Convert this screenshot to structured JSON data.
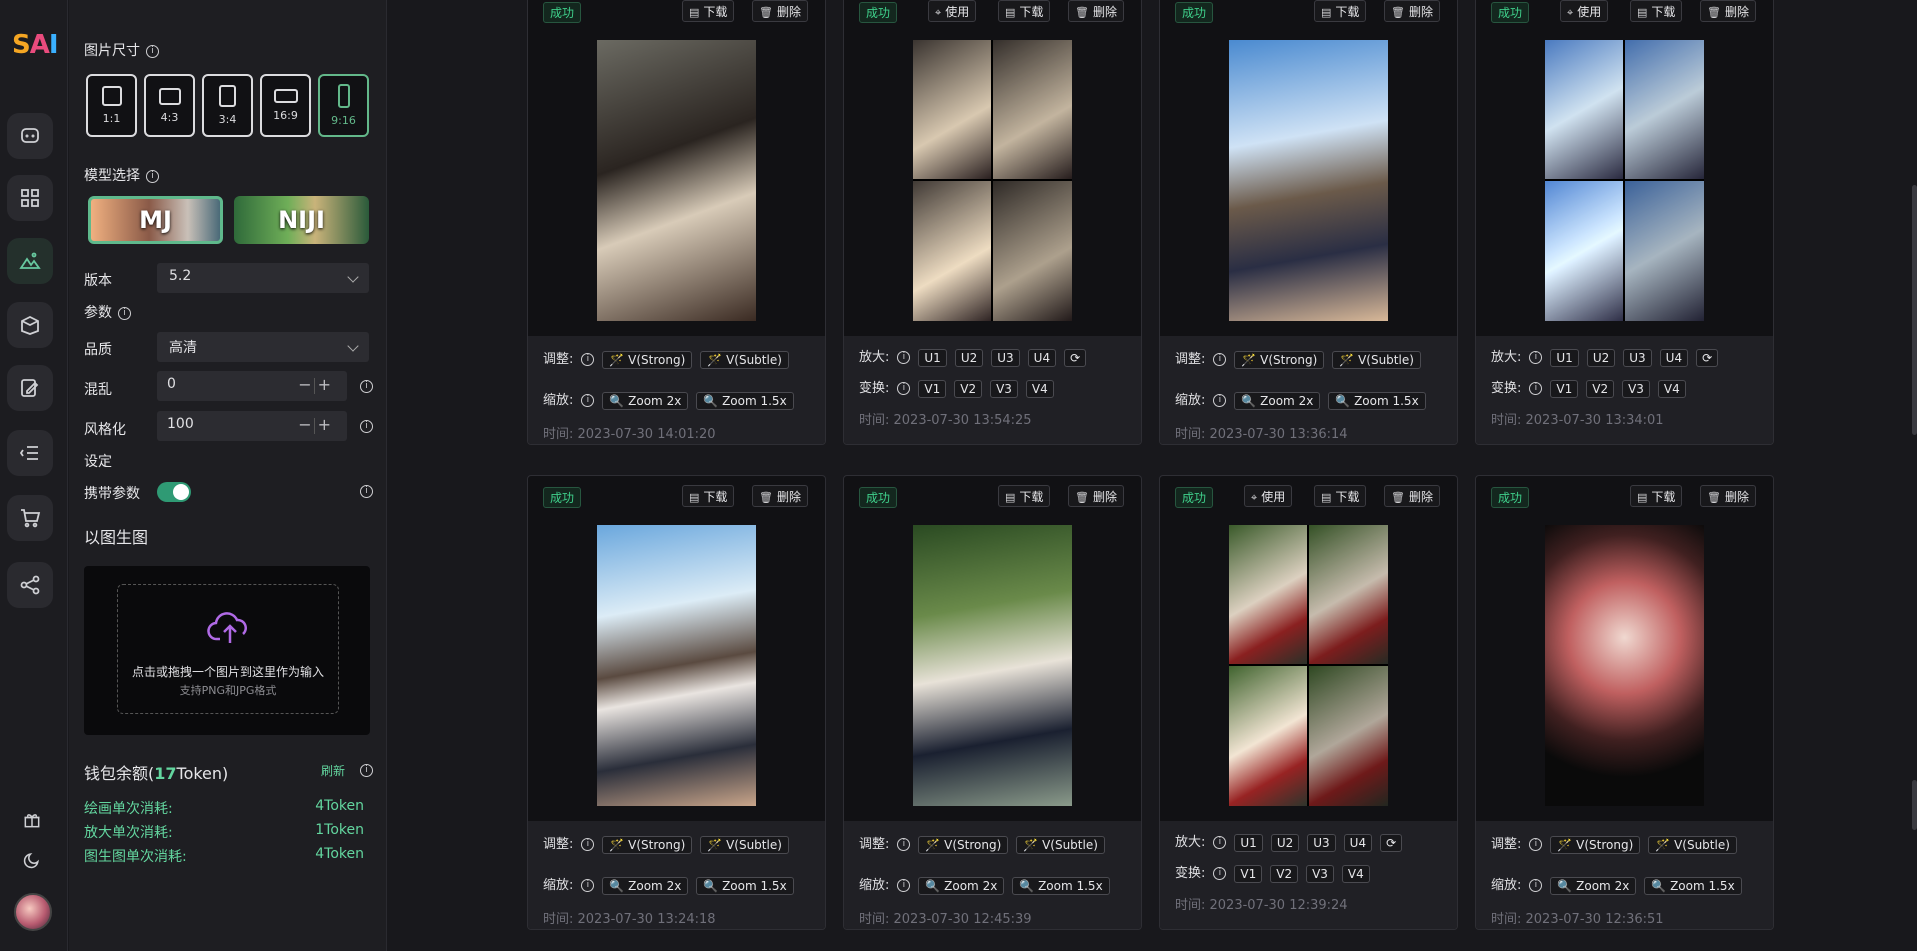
{
  "sidebar": {
    "logo": {
      "s": "S",
      "a": "A",
      "i": "I"
    }
  },
  "settings": {
    "size_label": "图片尺寸",
    "ratios": [
      "1:1",
      "4:3",
      "3:4",
      "16:9",
      "9:16"
    ],
    "selected_ratio": "9:16",
    "model_label": "模型选择",
    "models": [
      "MJ",
      "NIJI"
    ],
    "version_label": "版本",
    "version_value": "5.2",
    "params_label": "参数",
    "quality_label": "品质",
    "quality_value": "高清",
    "chaos_label": "混乱",
    "chaos_value": "0",
    "stylize_label": "风格化",
    "stylize_value": "100",
    "setting_label": "设定",
    "carry_label": "携带参数",
    "img2img_label": "以图生图",
    "upload_text": "点击或拖拽一个图片到这里作为输入",
    "upload_hint": "支持PNG和JPG格式",
    "stepper": "−+"
  },
  "wallet": {
    "prefix": "钱包余额(",
    "amount": "17",
    "suffix": "Token)",
    "refresh": "刷新",
    "costs": [
      {
        "label": "绘画单次消耗:",
        "value": "4Token"
      },
      {
        "label": "放大单次消耗:",
        "value": "1Token"
      },
      {
        "label": "图生图单次消耗:",
        "value": "4Token"
      }
    ]
  },
  "labels": {
    "status": "成功",
    "use": "使用",
    "download": "下载",
    "delete": "删除",
    "adjust": "调整:",
    "zoom": "缩放:",
    "upscale": "放大:",
    "vary": "变换:",
    "v_strong": "V(Strong)",
    "v_subtle": "V(Subtle)",
    "zoom2": "Zoom 2x",
    "zoom15": "Zoom 1.5x",
    "u": [
      "U1",
      "U2",
      "U3",
      "U4"
    ],
    "v": [
      "V1",
      "V2",
      "V3",
      "V4"
    ]
  },
  "cards": [
    {
      "type": "single",
      "use": false,
      "time": "时间: 2023-07-30 14:01:20"
    },
    {
      "type": "grid",
      "use": true,
      "time": "时间: 2023-07-30 13:54:25"
    },
    {
      "type": "single",
      "use": false,
      "time": "时间: 2023-07-30 13:36:14"
    },
    {
      "type": "grid",
      "use": true,
      "time": "时间: 2023-07-30 13:34:01"
    },
    {
      "type": "single",
      "use": false,
      "time": "时间: 2023-07-30 13:24:18"
    },
    {
      "type": "single",
      "use": false,
      "time": "时间: 2023-07-30 12:45:39"
    },
    {
      "type": "grid",
      "use": true,
      "time": "时间: 2023-07-30 12:39:24"
    },
    {
      "type": "single",
      "use": false,
      "time": "时间: 2023-07-30 12:36:51"
    }
  ]
}
